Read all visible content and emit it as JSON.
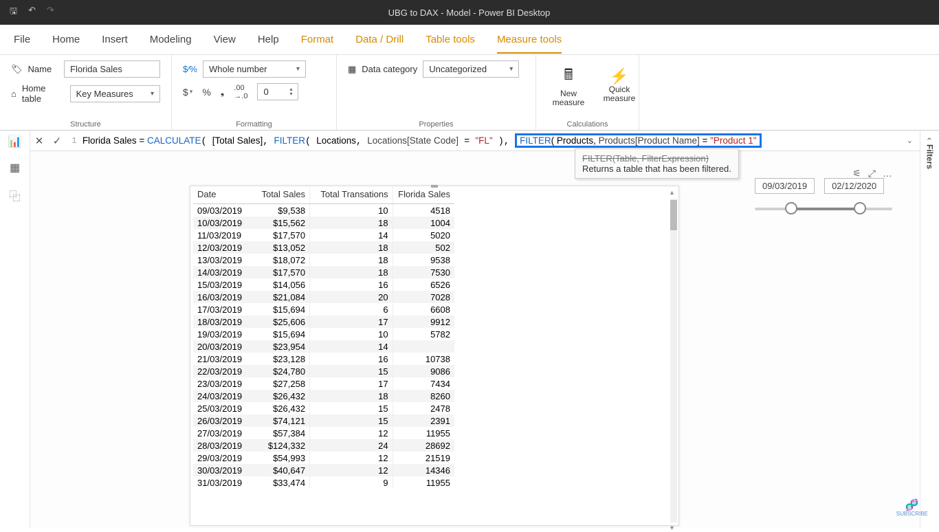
{
  "titlebar": {
    "title": "UBG to DAX - Model - Power BI Desktop"
  },
  "menu": {
    "file": "File",
    "home": "Home",
    "insert": "Insert",
    "modeling": "Modeling",
    "view": "View",
    "help": "Help",
    "format": "Format",
    "datadrill": "Data / Drill",
    "tabletools": "Table tools",
    "measuretools": "Measure tools"
  },
  "ribbon": {
    "name_label": "Name",
    "name_value": "Florida Sales",
    "hometable_label": "Home table",
    "hometable_value": "Key Measures",
    "format_value": "Whole number",
    "decimals_value": "0",
    "datacat_label": "Data category",
    "datacat_value": "Uncategorized",
    "newmeasure": "New measure",
    "quickmeasure": "Quick measure",
    "grp_structure": "Structure",
    "grp_formatting": "Formatting",
    "grp_properties": "Properties",
    "grp_calculations": "Calculations",
    "sym_dollar": "$",
    "sym_percent": "%",
    "sym_comma": "❟"
  },
  "formula": {
    "lineno": "1",
    "prefix_measure": "Florida Sales = ",
    "fn_calculate": "CALCULATE",
    "arg_total": "[Total Sales]",
    "fn_filter": "FILTER",
    "tbl_locations": "Locations",
    "col_state": "Locations[State Code]",
    "lit_fl": "\"FL\"",
    "tbl_products": "Products",
    "col_prodname": "Products[Product Name]",
    "lit_prod1": "\"Product 1\"",
    "tooltip_sig": "FILTER(Table, FilterExpression)",
    "tooltip_desc": "Returns a table that has been filtered."
  },
  "slicer": {
    "date_from": "09/03/2019",
    "date_to": "02/12/2020"
  },
  "tableviz": {
    "headers": [
      "Date",
      "Total Sales",
      "Total Transations",
      "Florida Sales"
    ],
    "rows": [
      [
        "09/03/2019",
        "$9,538",
        "10",
        "4518"
      ],
      [
        "10/03/2019",
        "$15,562",
        "18",
        "1004"
      ],
      [
        "11/03/2019",
        "$17,570",
        "14",
        "5020"
      ],
      [
        "12/03/2019",
        "$13,052",
        "18",
        "502"
      ],
      [
        "13/03/2019",
        "$18,072",
        "18",
        "9538"
      ],
      [
        "14/03/2019",
        "$17,570",
        "18",
        "7530"
      ],
      [
        "15/03/2019",
        "$14,056",
        "16",
        "6526"
      ],
      [
        "16/03/2019",
        "$21,084",
        "20",
        "7028"
      ],
      [
        "17/03/2019",
        "$15,694",
        "6",
        "6608"
      ],
      [
        "18/03/2019",
        "$25,606",
        "17",
        "9912"
      ],
      [
        "19/03/2019",
        "$15,694",
        "10",
        "5782"
      ],
      [
        "20/03/2019",
        "$23,954",
        "14",
        ""
      ],
      [
        "21/03/2019",
        "$23,128",
        "16",
        "10738"
      ],
      [
        "22/03/2019",
        "$24,780",
        "15",
        "9086"
      ],
      [
        "23/03/2019",
        "$27,258",
        "17",
        "7434"
      ],
      [
        "24/03/2019",
        "$26,432",
        "18",
        "8260"
      ],
      [
        "25/03/2019",
        "$26,432",
        "15",
        "2478"
      ],
      [
        "26/03/2019",
        "$74,121",
        "15",
        "2391"
      ],
      [
        "27/03/2019",
        "$57,384",
        "12",
        "11955"
      ],
      [
        "28/03/2019",
        "$124,332",
        "24",
        "28692"
      ],
      [
        "29/03/2019",
        "$54,993",
        "12",
        "21519"
      ],
      [
        "30/03/2019",
        "$40,647",
        "12",
        "14346"
      ],
      [
        "31/03/2019",
        "$33,474",
        "9",
        "11955"
      ]
    ]
  },
  "filters_label": "Filters",
  "subscribe": "SUBSCRIBE"
}
